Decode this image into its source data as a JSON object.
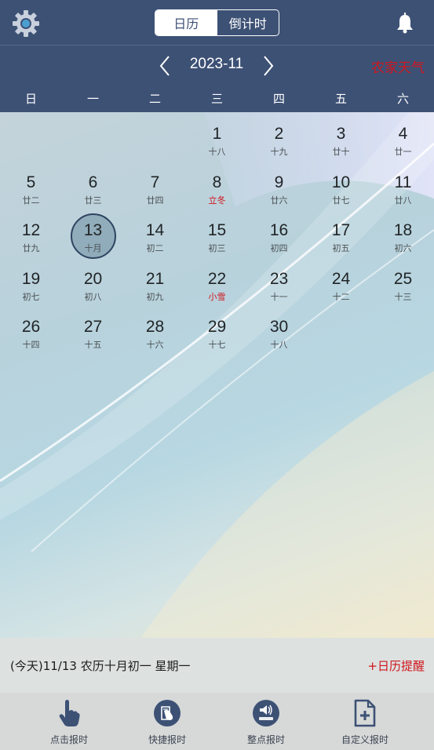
{
  "header": {
    "tabs": [
      {
        "label": "日历",
        "active": true
      },
      {
        "label": "倒计时",
        "active": false
      }
    ]
  },
  "month_nav": {
    "current": "2023-11",
    "weather_link": "农家天气"
  },
  "weekdays": [
    "日",
    "一",
    "二",
    "三",
    "四",
    "五",
    "六"
  ],
  "days": [
    {
      "day": "1",
      "lunar": "十八",
      "col": 3,
      "row": 0
    },
    {
      "day": "2",
      "lunar": "十九",
      "col": 4,
      "row": 0
    },
    {
      "day": "3",
      "lunar": "廿十",
      "col": 5,
      "row": 0
    },
    {
      "day": "4",
      "lunar": "廿一",
      "col": 6,
      "row": 0
    },
    {
      "day": "5",
      "lunar": "廿二",
      "col": 0,
      "row": 1
    },
    {
      "day": "6",
      "lunar": "廿三",
      "col": 1,
      "row": 1
    },
    {
      "day": "7",
      "lunar": "廿四",
      "col": 2,
      "row": 1
    },
    {
      "day": "8",
      "lunar": "立冬",
      "col": 3,
      "row": 1,
      "term": true
    },
    {
      "day": "9",
      "lunar": "廿六",
      "col": 4,
      "row": 1
    },
    {
      "day": "10",
      "lunar": "廿七",
      "col": 5,
      "row": 1
    },
    {
      "day": "11",
      "lunar": "廿八",
      "col": 6,
      "row": 1
    },
    {
      "day": "12",
      "lunar": "廿九",
      "col": 0,
      "row": 2
    },
    {
      "day": "13",
      "lunar": "十月",
      "col": 1,
      "row": 2,
      "today": true
    },
    {
      "day": "14",
      "lunar": "初二",
      "col": 2,
      "row": 2
    },
    {
      "day": "15",
      "lunar": "初三",
      "col": 3,
      "row": 2
    },
    {
      "day": "16",
      "lunar": "初四",
      "col": 4,
      "row": 2
    },
    {
      "day": "17",
      "lunar": "初五",
      "col": 5,
      "row": 2
    },
    {
      "day": "18",
      "lunar": "初六",
      "col": 6,
      "row": 2
    },
    {
      "day": "19",
      "lunar": "初七",
      "col": 0,
      "row": 3
    },
    {
      "day": "20",
      "lunar": "初八",
      "col": 1,
      "row": 3
    },
    {
      "day": "21",
      "lunar": "初九",
      "col": 2,
      "row": 3
    },
    {
      "day": "22",
      "lunar": "小雪",
      "col": 3,
      "row": 3,
      "term": true
    },
    {
      "day": "23",
      "lunar": "十一",
      "col": 4,
      "row": 3
    },
    {
      "day": "24",
      "lunar": "十二",
      "col": 5,
      "row": 3
    },
    {
      "day": "25",
      "lunar": "十三",
      "col": 6,
      "row": 3
    },
    {
      "day": "26",
      "lunar": "十四",
      "col": 0,
      "row": 4
    },
    {
      "day": "27",
      "lunar": "十五",
      "col": 1,
      "row": 4
    },
    {
      "day": "28",
      "lunar": "十六",
      "col": 2,
      "row": 4
    },
    {
      "day": "29",
      "lunar": "十七",
      "col": 3,
      "row": 4
    },
    {
      "day": "30",
      "lunar": "十八",
      "col": 4,
      "row": 4
    }
  ],
  "info": {
    "today": "(今天)11/13  农历十月初一  星期一",
    "reminder": "+日历提醒"
  },
  "toolbar": [
    {
      "label": "点击报时",
      "icon": "tap-hand-icon"
    },
    {
      "label": "快捷报时",
      "icon": "quick-announce-icon"
    },
    {
      "label": "整点报时",
      "icon": "hourly-chime-icon"
    },
    {
      "label": "自定义报时",
      "icon": "custom-document-icon"
    }
  ],
  "colors": {
    "header_bg": "#3d5175",
    "accent_red": "#d0151c"
  }
}
